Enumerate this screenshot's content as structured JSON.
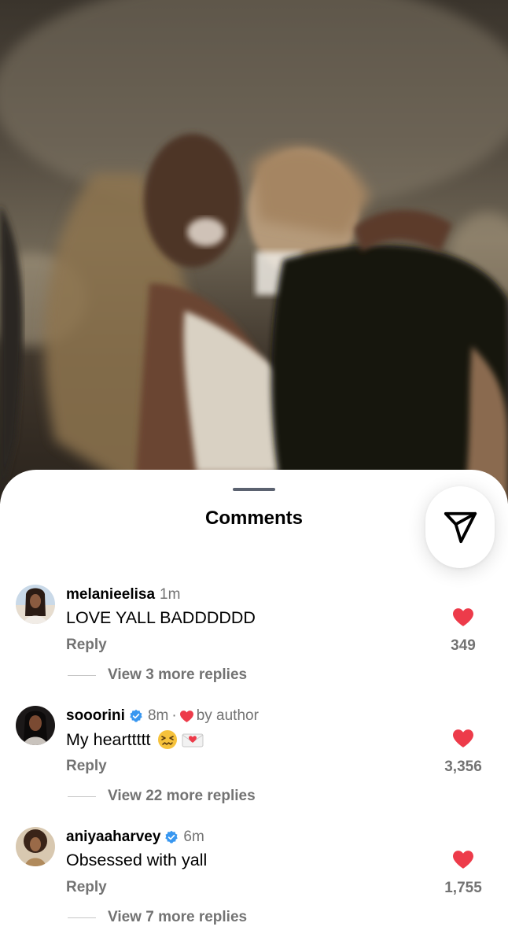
{
  "sheet": {
    "title": "Comments"
  },
  "comments": [
    {
      "username": "melanieelisa",
      "time": "1m",
      "verified": false,
      "text": "LOVE YALL BADDDDDD",
      "reply_label": "Reply",
      "like_count": "349",
      "view_replies": "View 3 more replies"
    },
    {
      "username": "sooorini",
      "time": "8m",
      "verified": true,
      "by_author": "by author",
      "text": "My hearttttt",
      "emojis": [
        "confounded-face-icon",
        "love-letter-icon"
      ],
      "reply_label": "Reply",
      "like_count": "3,356",
      "view_replies": "View 22 more replies"
    },
    {
      "username": "aniyaaharvey",
      "time": "6m",
      "verified": true,
      "text": "Obsessed with yall",
      "reply_label": "Reply",
      "like_count": "1,755",
      "view_replies": "View 7 more replies"
    }
  ],
  "colors": {
    "heart": "#ed3b4a",
    "verified": "#3897f0",
    "secondary_text": "#737373"
  },
  "icons": {
    "share": "paper-plane-icon",
    "like": "heart-filled-icon"
  }
}
